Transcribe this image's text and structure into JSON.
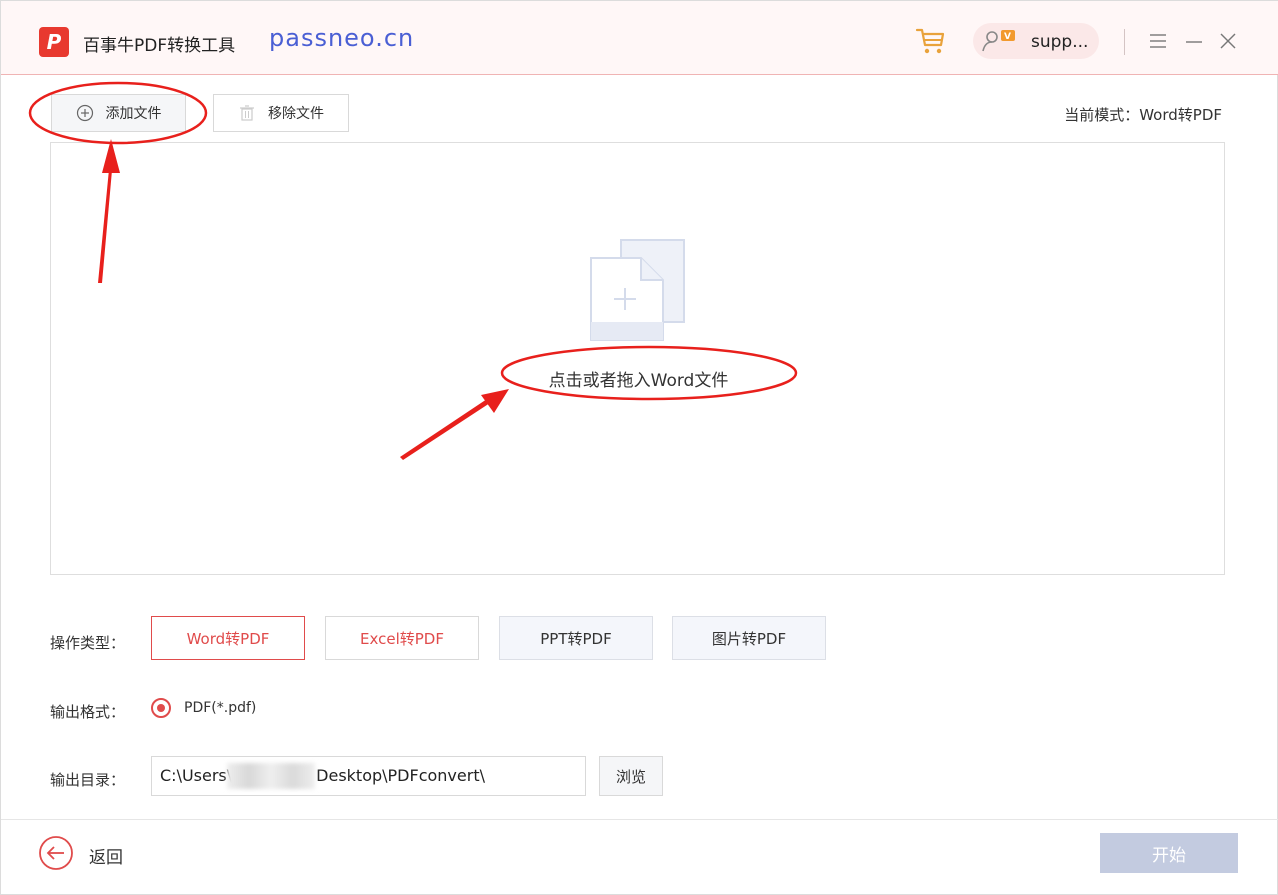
{
  "window": {
    "title": "百事牛PDF转换工具",
    "subtitle": "passneo.cn",
    "logo_letter": "P",
    "user_name": "supp...",
    "vip_badge": "V",
    "icons": [
      "cart-icon",
      "user-icon",
      "menu-icon",
      "minimize-icon",
      "close-icon"
    ]
  },
  "toolbar": {
    "add_label": "添加文件",
    "remove_label": "移除文件",
    "mode_text": "当前模式：Word转PDF"
  },
  "dropzone": {
    "prompt": "点击或者拖入Word文件",
    "icon": "add-file-icon"
  },
  "options": {
    "operation_label": "操作类型：",
    "operation_types": [
      "Word转PDF",
      "Excel转PDF",
      "PPT转PDF",
      "图片转PDF"
    ],
    "selected_operation": "Word转PDF",
    "format_label": "输出格式：",
    "format_value": "PDF(*.pdf)",
    "dir_label": "输出目录：",
    "dir_value_prefix": "C:\\Users\\",
    "dir_value_suffix": "Desktop\\PDFconvert\\",
    "browse_label": "浏览"
  },
  "footer": {
    "back_label": "返回",
    "start_label": "开始"
  },
  "colors": {
    "accent": "#e04b4b",
    "brand_blue": "#4a5fd4",
    "start_disabled": "#c3cbe0",
    "annotation": "#e8201c"
  }
}
